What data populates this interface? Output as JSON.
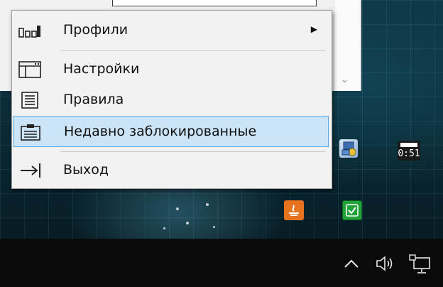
{
  "menu": {
    "items": [
      {
        "id": "profiles",
        "label": "Профили",
        "icon": "bar-chart-icon",
        "has_submenu": true
      },
      {
        "id": "settings",
        "label": "Настройки",
        "icon": "settings-window-icon"
      },
      {
        "id": "rules",
        "label": "Правила",
        "icon": "rules-document-icon"
      },
      {
        "id": "recently_blocked",
        "label": "Недавно заблокированные",
        "icon": "clipboard-list-icon",
        "highlighted": true
      },
      {
        "id": "exit",
        "label": "Выход",
        "icon": "exit-arrow-icon"
      }
    ]
  },
  "tray": {
    "timer_text": "0:51",
    "icons": [
      "network-gear-icon",
      "timer-icon",
      "java-icon",
      "checkmark-icon"
    ]
  },
  "taskbar": {
    "icons": [
      "show-hidden-icons-chevron",
      "volume-icon",
      "network-icon"
    ]
  },
  "colors": {
    "menu_highlight": "#cce4f7",
    "menu_highlight_border": "#5ea6df",
    "java_orange": "#e8731e",
    "check_green": "#22a33a"
  }
}
